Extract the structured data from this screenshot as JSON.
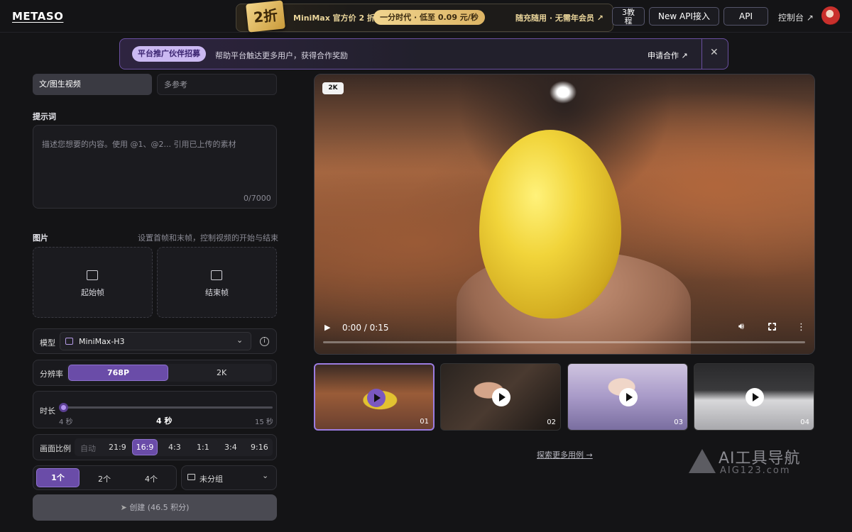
{
  "header": {
    "logo": "METASO",
    "promo": {
      "badge": "2折",
      "text1": "MiniMax 官方价 2 折",
      "pill": "一分时代 · 低至 0.09 元/秒",
      "text2": "随充随用 · 无需年会员 ↗"
    },
    "buttons": [
      "3教\n程",
      "New API接入",
      "API"
    ],
    "console": "控制台 ↗"
  },
  "banner": {
    "pill": "平台推广伙伴招募",
    "text": "帮助平台触达更多用户，获得合作奖励",
    "apply": "申请合作 ↗",
    "close": "✕"
  },
  "left": {
    "tabs": [
      "文/图生视频",
      "多参考"
    ],
    "prompt_label": "提示词",
    "prompt_placeholder": "描述您想要的内容。使用 @1、@2... 引用已上传的素材",
    "prompt_count": "0/7000",
    "image_label": "图片",
    "image_hint": "设置首帧和末帧，控制视频的开始与结束",
    "start_frame": "起始帧",
    "end_frame": "结束帧",
    "model_label": "模型",
    "model_value": "MiniMax-H3",
    "resolution_label": "分辨率",
    "resolution_options": [
      "768P",
      "2K"
    ],
    "resolution_selected": "768P",
    "duration_label": "时长",
    "duration_min": "4 秒",
    "duration_value": "4 秒",
    "duration_max": "15 秒",
    "ratio_label": "画面比例",
    "ratio_options": [
      "自动",
      "21:9",
      "16:9",
      "4:3",
      "1:1",
      "3:4",
      "9:16"
    ],
    "ratio_selected": "16:9",
    "count_options": [
      "1个",
      "2个",
      "4个"
    ],
    "count_selected": "1个",
    "group_value": "未分组",
    "create_label": "创建 (46.5 积分)"
  },
  "video": {
    "badge": "2K",
    "time": "0:00 / 0:15",
    "progress": 0
  },
  "thumbnails": [
    {
      "num": "01",
      "selected": true
    },
    {
      "num": "02",
      "selected": false
    },
    {
      "num": "03",
      "selected": false
    },
    {
      "num": "04",
      "selected": false
    }
  ],
  "explore": "探索更多用例 →",
  "watermark": {
    "line1": "AI工具导航",
    "line2": "AIG123.com"
  },
  "colors": {
    "accent": "#6a4ca8",
    "background": "#141416",
    "gold": "#e9d49a"
  }
}
